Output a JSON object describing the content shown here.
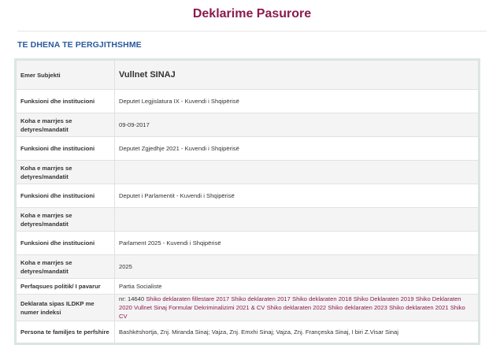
{
  "page": {
    "title": "Deklarime Pasurore"
  },
  "section": {
    "title": "TE DHENA TE PERGJITHSHME"
  },
  "rows": [
    {
      "label": "Emer Subjekti",
      "value": "Vullnet SINAJ"
    },
    {
      "label": "Funksioni dhe institucioni",
      "value": "Deputet Legjislatura IX - Kuvendi i Shqipërisë"
    },
    {
      "label": "Koha e marrjes se detyres/mandatit",
      "value": "09-09-2017"
    },
    {
      "label": "Funksioni dhe institucioni",
      "value": "Deputet Zgjedhje 2021 - Kuvendi i Shqipërisë"
    },
    {
      "label": "Koha e marrjes se detyres/mandatit",
      "value": ""
    },
    {
      "label": "Funksioni dhe institucioni",
      "value": "Deputet i Parlamentit - Kuvendi i Shqipërisë"
    },
    {
      "label": "Koha e marrjes se detyres/mandatit",
      "value": ""
    },
    {
      "label": "Funksioni dhe institucioni",
      "value": "Parlament 2025 - Kuvendi i Shqipërisë"
    },
    {
      "label": "Koha e marrjes se detyres/mandatit",
      "value": "2025"
    },
    {
      "label": "Perfaqsues politik/ I pavarur",
      "value": "Partia Socialiste"
    },
    {
      "label": "Deklarata sipas ILDKP me numer indeksi",
      "value": "nr: 14640"
    },
    {
      "label": "Persona te familjes te perfshire",
      "value": "Bashkëshortja, Znj. Miranda Sinaj; Vajza, Znj. Emxhi Sinaj; Vajza, Znj. Françeska Sinaj, I biri Z.Visar Sinaj"
    }
  ],
  "declaration_links": [
    "Shiko deklaraten fillestare 2017",
    "Shiko deklaraten 2017",
    "Shiko deklaraten 2018",
    "Shiko Deklaraten 2019",
    "Shiko Deklaraten 2020",
    "Vullnet Sinaj Formular Dekriminalizimi 2021 & CV",
    "Shiko deklaraten 2022",
    "Shiko deklaraten 2023",
    "Shiko deklaraten 2021",
    "Shiko CV"
  ]
}
